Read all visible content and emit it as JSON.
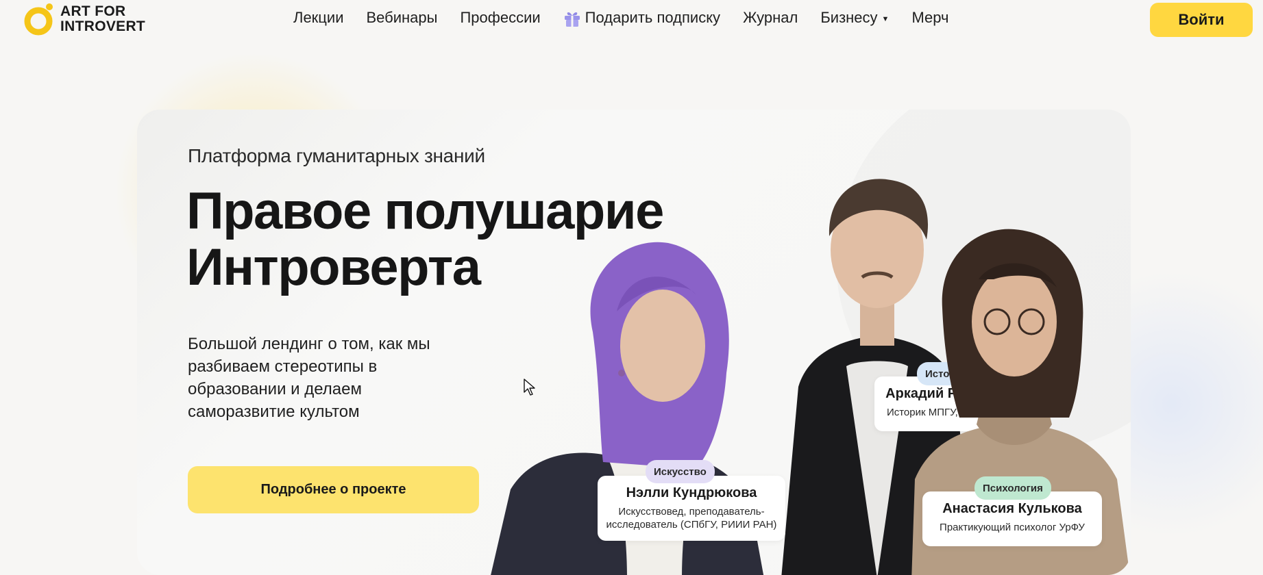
{
  "brand": {
    "line1": "ART FOR",
    "line2": "INTROVERT",
    "logo_icon": "logo-ring-icon",
    "accent": "#ffd740"
  },
  "nav": {
    "items": [
      {
        "label": "Лекции"
      },
      {
        "label": "Вебинары"
      },
      {
        "label": "Профессии"
      },
      {
        "label": "Подарить подписку",
        "icon": "gift-icon"
      },
      {
        "label": "Журнал"
      },
      {
        "label": "Бизнесу",
        "icon": "caret-down-icon"
      },
      {
        "label": "Мерч"
      }
    ],
    "login_label": "Войти"
  },
  "hero": {
    "eyebrow": "Платформа гуманитарных знаний",
    "title_line1": "Правое полушарие",
    "title_line2": "Интроверта",
    "description": "Большой лендинг о том, как мы разбиваем стереотипы в образовании и делаем саморазвитие культом",
    "cta_label": "Подробнее о проекте",
    "cta_color": "#fde36e"
  },
  "speakers": [
    {
      "tag": "Искусство",
      "tag_color": "#e3ddf6",
      "name": "Нэлли Кундрюкова",
      "role_line1": "Искусствовед, преподаватель-",
      "role_line2": "исследователь (СПбГУ, РИИИ РАН)"
    },
    {
      "tag": "История",
      "tag_color": "#d6e6f7",
      "name": "Аркадий Романов",
      "role_line1": "Историк МПГУ, музыкант"
    },
    {
      "tag": "Психология",
      "tag_color": "#bfe8d0",
      "name": "Анастасия Кулькова",
      "role_line1": "Практикующий психолог УрФУ"
    }
  ]
}
